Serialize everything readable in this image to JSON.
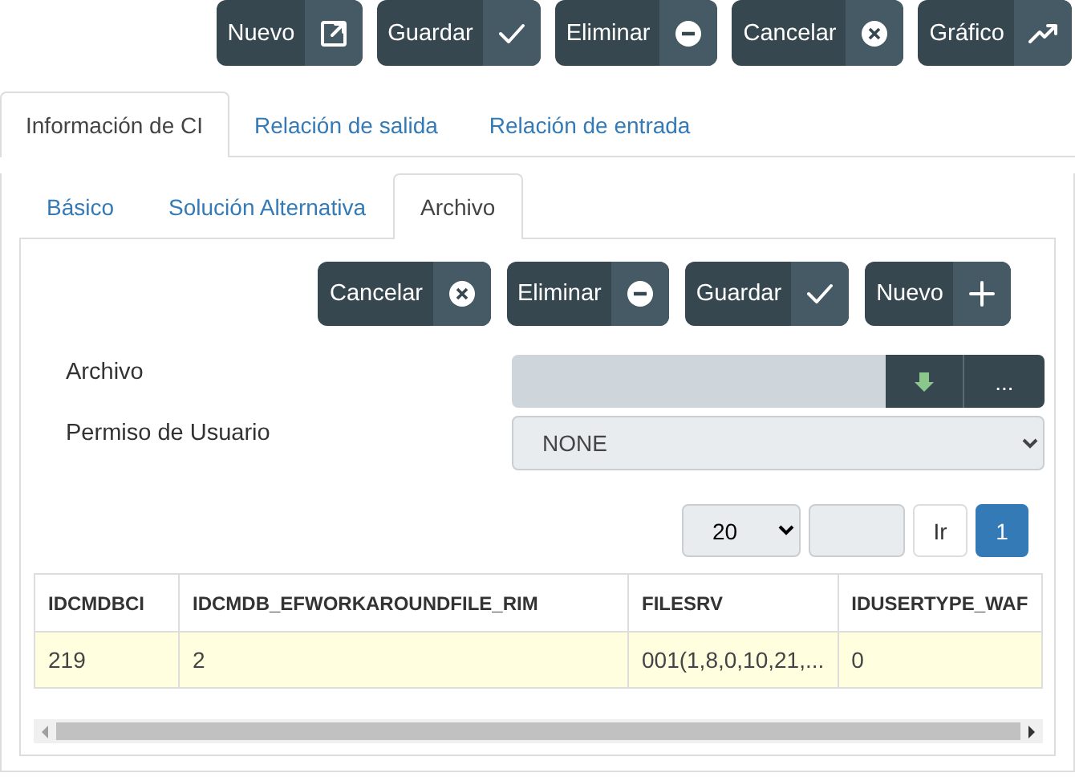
{
  "toolbar": [
    {
      "label": "Nuevo",
      "kind": "open"
    },
    {
      "label": "Guardar",
      "kind": "save"
    },
    {
      "label": "Eliminar",
      "kind": "delete"
    },
    {
      "label": "Cancelar",
      "kind": "cancel"
    },
    {
      "label": "Gráfico",
      "kind": "chart"
    }
  ],
  "tabs": [
    {
      "label": "Información de CI",
      "selected": true
    },
    {
      "label": "Relación de salida",
      "selected": false
    },
    {
      "label": "Relación de entrada",
      "selected": false
    }
  ],
  "subtabs": [
    {
      "label": "Básico",
      "selected": false
    },
    {
      "label": "Solución Alternativa",
      "selected": false
    },
    {
      "label": "Archivo",
      "selected": true
    }
  ],
  "actions": [
    {
      "label": "Cancelar",
      "kind": "cancel"
    },
    {
      "label": "Eliminar",
      "kind": "delete"
    },
    {
      "label": "Guardar",
      "kind": "save"
    },
    {
      "label": "Nuevo",
      "kind": "add"
    }
  ],
  "form": {
    "file_label": "Archivo",
    "browse_button": "...",
    "permission_label": "Permiso de Usuario",
    "permission_value": "NONE"
  },
  "pager": {
    "page_size": "20",
    "go_button": "Ir",
    "pages": [
      {
        "label": "1",
        "selected": true
      }
    ]
  },
  "table": {
    "columns": [
      "IDCMDBCI",
      "IDCMDB_EFWORKAROUNDFILE_RIM",
      "FILESRV",
      "IDUSERTYPE_WAF"
    ],
    "rows": [
      {
        "cells": [
          "219",
          "2",
          "001(1,8,0,10,21,...",
          "0"
        ],
        "selected": true
      }
    ]
  }
}
